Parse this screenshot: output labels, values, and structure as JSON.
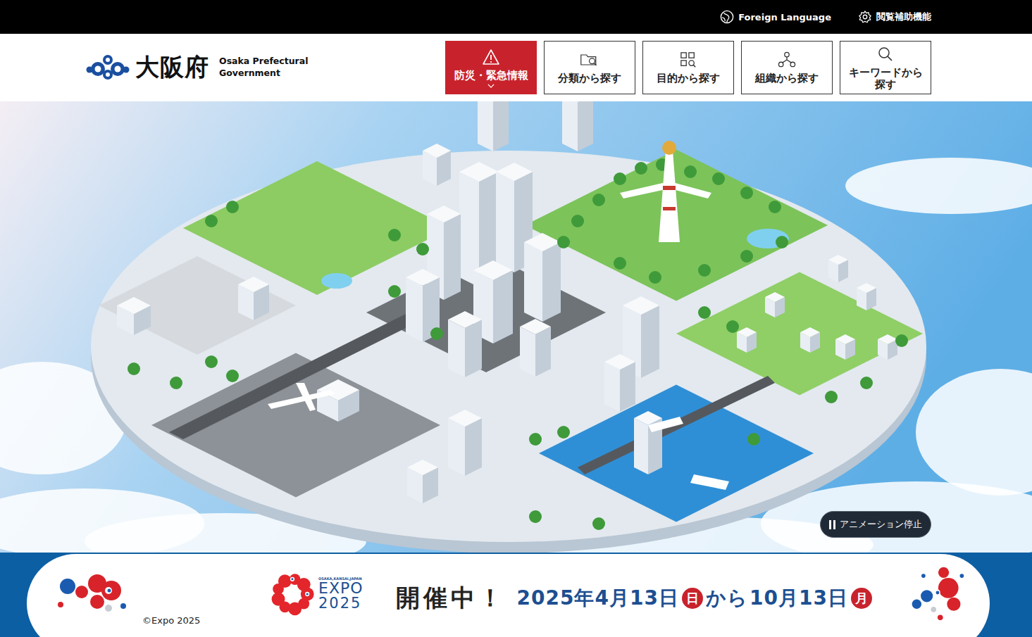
{
  "topbar": {
    "language": "Foreign Language",
    "accessibility": "閲覧補助機能"
  },
  "logo": {
    "name": "大阪府",
    "subtitle_lines": [
      "Osaka Prefectural",
      "Government"
    ]
  },
  "nav": [
    {
      "label": "防災・緊急情報",
      "kind": "emergency"
    },
    {
      "label": "分類から探す",
      "kind": "normal"
    },
    {
      "label": "目的から探す",
      "kind": "normal"
    },
    {
      "label": "組織から探す",
      "kind": "normal"
    },
    {
      "label": "キーワードから探す",
      "kind": "normal"
    }
  ],
  "hero": {
    "pause_button": "アニメーション停止"
  },
  "expo": {
    "copyright": "©Expo 2025",
    "logo": {
      "region": "OSAKA,KANSAI,JAPAN",
      "word": "EXPO",
      "year": "2025"
    },
    "status": "開催中！",
    "start_date": "2025年4月13日",
    "start_day": "日",
    "connector": "から",
    "end_date": "10月13日",
    "end_day": "月"
  }
}
